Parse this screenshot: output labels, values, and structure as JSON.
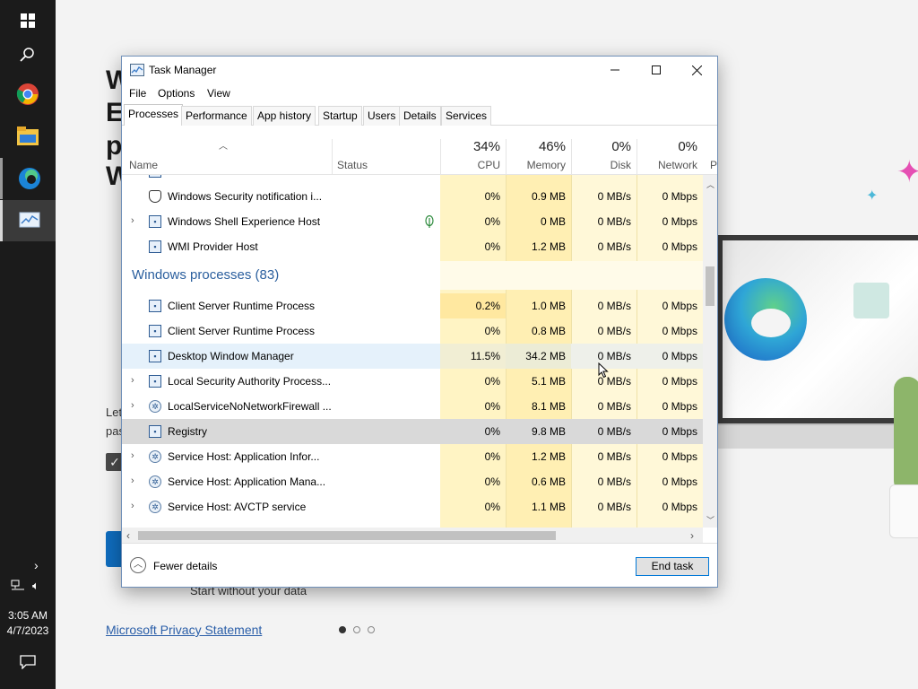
{
  "taskbar": {
    "time": "3:05 AM",
    "date": "4/7/2023",
    "icons": [
      "windows-start-icon",
      "search-icon",
      "chrome-icon",
      "file-explorer-icon",
      "edge-icon",
      "task-manager-icon"
    ]
  },
  "background_app": {
    "heading_fragments": [
      "W",
      "E",
      "p",
      "W"
    ],
    "body_fragments": [
      "Let",
      "pas"
    ],
    "start_without": "Start without your data",
    "privacy_link": "Microsoft Privacy Statement"
  },
  "task_manager": {
    "title": "Task Manager",
    "menu": [
      "File",
      "Options",
      "View"
    ],
    "tabs": [
      "Processes",
      "Performance",
      "App history",
      "Startup",
      "Users",
      "Details",
      "Services"
    ],
    "active_tab": "Processes",
    "columns": {
      "name": "Name",
      "status": "Status",
      "cpu": {
        "label": "CPU",
        "pct": "34%"
      },
      "memory": {
        "label": "Memory",
        "pct": "46%"
      },
      "disk": {
        "label": "Disk",
        "pct": "0%"
      },
      "network": {
        "label": "Network",
        "pct": "0%"
      },
      "power": "P"
    },
    "rows": [
      {
        "name": "Windows Security notification i...",
        "cpu": "0%",
        "memory": "0.9 MB",
        "disk": "0 MB/s",
        "network": "0 Mbps",
        "icon": "shield-icon",
        "expandable": false
      },
      {
        "name": "Windows Shell Experience Host",
        "cpu": "0%",
        "memory": "0 MB",
        "disk": "0 MB/s",
        "network": "0 Mbps",
        "icon": "app-icon",
        "expandable": true,
        "status_icon": "leaf-icon"
      },
      {
        "name": "WMI Provider Host",
        "cpu": "0%",
        "memory": "1.2 MB",
        "disk": "0 MB/s",
        "network": "0 Mbps",
        "icon": "wmi-icon",
        "expandable": false
      }
    ],
    "group": {
      "title": "Windows processes (83)"
    },
    "group_rows": [
      {
        "name": "Client Server Runtime Process",
        "cpu": "0.2%",
        "memory": "1.0 MB",
        "disk": "0 MB/s",
        "network": "0 Mbps",
        "expandable": false
      },
      {
        "name": "Client Server Runtime Process",
        "cpu": "0%",
        "memory": "0.8 MB",
        "disk": "0 MB/s",
        "network": "0 Mbps",
        "expandable": false
      },
      {
        "name": "Desktop Window Manager",
        "cpu": "11.5%",
        "memory": "34.2 MB",
        "disk": "0 MB/s",
        "network": "0 Mbps",
        "expandable": false
      },
      {
        "name": "Local Security Authority Process...",
        "cpu": "0%",
        "memory": "5.1 MB",
        "disk": "0 MB/s",
        "network": "0 Mbps",
        "expandable": true
      },
      {
        "name": "LocalServiceNoNetworkFirewall ...",
        "cpu": "0%",
        "memory": "8.1 MB",
        "disk": "0 MB/s",
        "network": "0 Mbps",
        "expandable": true
      },
      {
        "name": "Registry",
        "cpu": "0%",
        "memory": "9.8 MB",
        "disk": "0 MB/s",
        "network": "0 Mbps",
        "expandable": false
      },
      {
        "name": "Service Host: Application Infor...",
        "cpu": "0%",
        "memory": "1.2 MB",
        "disk": "0 MB/s",
        "network": "0 Mbps",
        "expandable": true
      },
      {
        "name": "Service Host: Application Mana...",
        "cpu": "0%",
        "memory": "0.6 MB",
        "disk": "0 MB/s",
        "network": "0 Mbps",
        "expandable": true
      },
      {
        "name": "Service Host: AVCTP service",
        "cpu": "0%",
        "memory": "1.1 MB",
        "disk": "0 MB/s",
        "network": "0 Mbps",
        "expandable": true
      }
    ],
    "footer": {
      "fewer_details": "Fewer details",
      "end_task": "End task"
    }
  },
  "colors": {
    "accent_blue": "#0078d7",
    "group_title": "#2b5f9e",
    "cpu_tint": "#fff4c4",
    "mem_tint": "#ffefb3",
    "disk_tint": "#fff8d8",
    "net_tint": "#fff8d8",
    "cpu_hot": "#ffe8a0"
  }
}
